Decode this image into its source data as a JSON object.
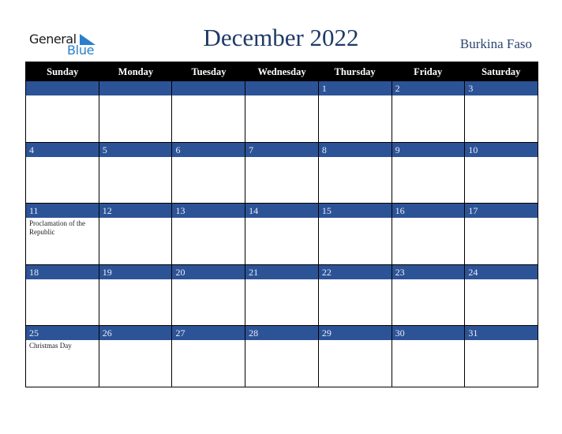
{
  "logo": {
    "word1": "General",
    "word2": "Blue"
  },
  "header": {
    "title": "December 2022",
    "country": "Burkina Faso"
  },
  "colors": {
    "band": "#2d5397",
    "title": "#1f3a66",
    "logo_blue": "#2a7fc9"
  },
  "weekdays": [
    "Sunday",
    "Monday",
    "Tuesday",
    "Wednesday",
    "Thursday",
    "Friday",
    "Saturday"
  ],
  "weeks": [
    [
      {
        "day": "",
        "holiday": ""
      },
      {
        "day": "",
        "holiday": ""
      },
      {
        "day": "",
        "holiday": ""
      },
      {
        "day": "",
        "holiday": ""
      },
      {
        "day": "1",
        "holiday": ""
      },
      {
        "day": "2",
        "holiday": ""
      },
      {
        "day": "3",
        "holiday": ""
      }
    ],
    [
      {
        "day": "4",
        "holiday": ""
      },
      {
        "day": "5",
        "holiday": ""
      },
      {
        "day": "6",
        "holiday": ""
      },
      {
        "day": "7",
        "holiday": ""
      },
      {
        "day": "8",
        "holiday": ""
      },
      {
        "day": "9",
        "holiday": ""
      },
      {
        "day": "10",
        "holiday": ""
      }
    ],
    [
      {
        "day": "11",
        "holiday": "Proclamation of the Republic"
      },
      {
        "day": "12",
        "holiday": ""
      },
      {
        "day": "13",
        "holiday": ""
      },
      {
        "day": "14",
        "holiday": ""
      },
      {
        "day": "15",
        "holiday": ""
      },
      {
        "day": "16",
        "holiday": ""
      },
      {
        "day": "17",
        "holiday": ""
      }
    ],
    [
      {
        "day": "18",
        "holiday": ""
      },
      {
        "day": "19",
        "holiday": ""
      },
      {
        "day": "20",
        "holiday": ""
      },
      {
        "day": "21",
        "holiday": ""
      },
      {
        "day": "22",
        "holiday": ""
      },
      {
        "day": "23",
        "holiday": ""
      },
      {
        "day": "24",
        "holiday": ""
      }
    ],
    [
      {
        "day": "25",
        "holiday": "Christmas Day"
      },
      {
        "day": "26",
        "holiday": ""
      },
      {
        "day": "27",
        "holiday": ""
      },
      {
        "day": "28",
        "holiday": ""
      },
      {
        "day": "29",
        "holiday": ""
      },
      {
        "day": "30",
        "holiday": ""
      },
      {
        "day": "31",
        "holiday": ""
      }
    ]
  ]
}
